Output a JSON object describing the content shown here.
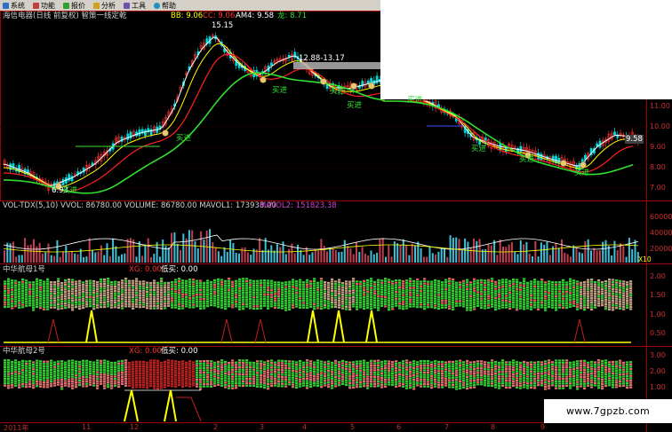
{
  "menubar": {
    "items": [
      {
        "label": "系统",
        "icon": "system-icon"
      },
      {
        "label": "功能",
        "icon": "function-icon"
      },
      {
        "label": "报价",
        "icon": "quote-icon"
      },
      {
        "label": "分析",
        "icon": "analysis-icon"
      },
      {
        "label": "工具",
        "icon": "tools-icon"
      },
      {
        "label": "帮助",
        "icon": "help-icon"
      }
    ]
  },
  "price_panel": {
    "title": "海信电器(日线 前复权) 智策一线定乾",
    "ind_bb": "BB: 9.06",
    "ind_cc": "CC: 9.06",
    "ind_am4": "AM4: 9.58",
    "ind_long": "龙: 8.71",
    "high_label": "15.15",
    "range_label": "12.88-13.17",
    "low_label": "6.93",
    "last_label": "9.58",
    "buy_label": "买进",
    "y_ticks": [
      "11.00",
      "10.00",
      "9.00",
      "8.00",
      "7.00"
    ]
  },
  "volume_panel": {
    "title": "VOL-TDX(5,10)  VVOL: 86780.00  VOLUME: 86780.00  MAVOL1: 173938.00",
    "mavol2": "MAVOL2: 151823.38",
    "y_ticks": [
      "60000",
      "40000",
      "20000"
    ],
    "unit": "X10"
  },
  "zh1_panel": {
    "title": "中华航母1号",
    "xg": "XG: 0.00",
    "dimai": "低买: 0.00",
    "y_ticks": [
      "2.00",
      "1.50",
      "1.00",
      "0.50"
    ]
  },
  "zh2_panel": {
    "title": "中华航母2号",
    "xg": "XG: 0.00",
    "dimai": "低买: 0.00",
    "y_ticks": [
      "3.00",
      "2.00",
      "1.00"
    ]
  },
  "x_axis": {
    "labels": [
      "2011年",
      "11",
      "12",
      "2",
      "3",
      "4",
      "5",
      "6",
      "7",
      "8",
      "9"
    ]
  },
  "watermark": "www.7gpzb.com",
  "colors": {
    "bull": "#ff3030",
    "bear": "#00d8d8",
    "ma_white": "#ffffff",
    "ma_yellow": "#ffff00",
    "ma_red": "#ff2020",
    "ma_green": "#30e030",
    "panel_border": "#b00000"
  }
}
